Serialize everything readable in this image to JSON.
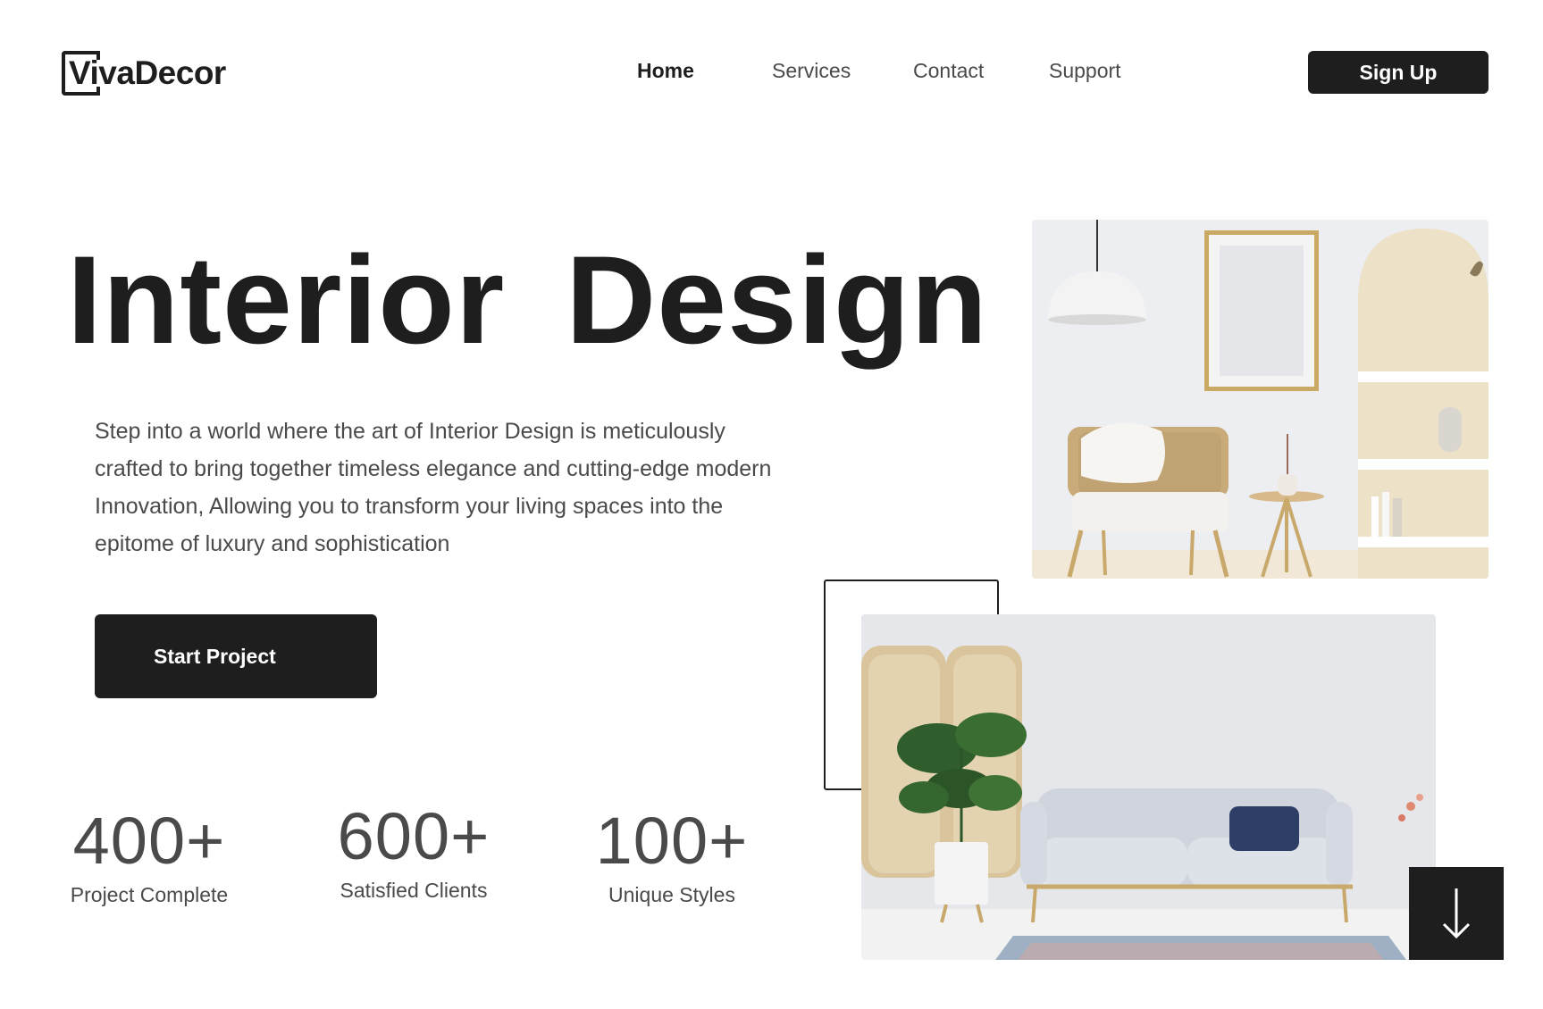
{
  "brand": {
    "name": "VivaDecor"
  },
  "nav": {
    "items": [
      {
        "label": "Home",
        "active": true
      },
      {
        "label": "Services",
        "active": false
      },
      {
        "label": "Contact",
        "active": false
      },
      {
        "label": "Support",
        "active": false
      }
    ],
    "signup_label": "Sign Up"
  },
  "hero": {
    "title": "Interior  Design",
    "description": "Step into a world where the art of Interior Design is meticulously crafted to bring together timeless elegance and cutting-edge modern Innovation, Allowing you to transform your living spaces into the epitome of luxury and sophistication",
    "cta_label": "Start Project"
  },
  "stats": [
    {
      "value": "400+",
      "label": "Project Complete"
    },
    {
      "value": "600+",
      "label": "Satisfied Clients"
    },
    {
      "value": "100+",
      "label": "Unique Styles"
    }
  ],
  "images": {
    "top": "living-room-armchair-photo",
    "bottom": "living-room-sofa-photo"
  },
  "icons": {
    "scroll": "arrow-down-icon"
  },
  "colors": {
    "dark": "#1e1e1e",
    "text_muted": "#4a4a4a",
    "background": "#ffffff"
  }
}
